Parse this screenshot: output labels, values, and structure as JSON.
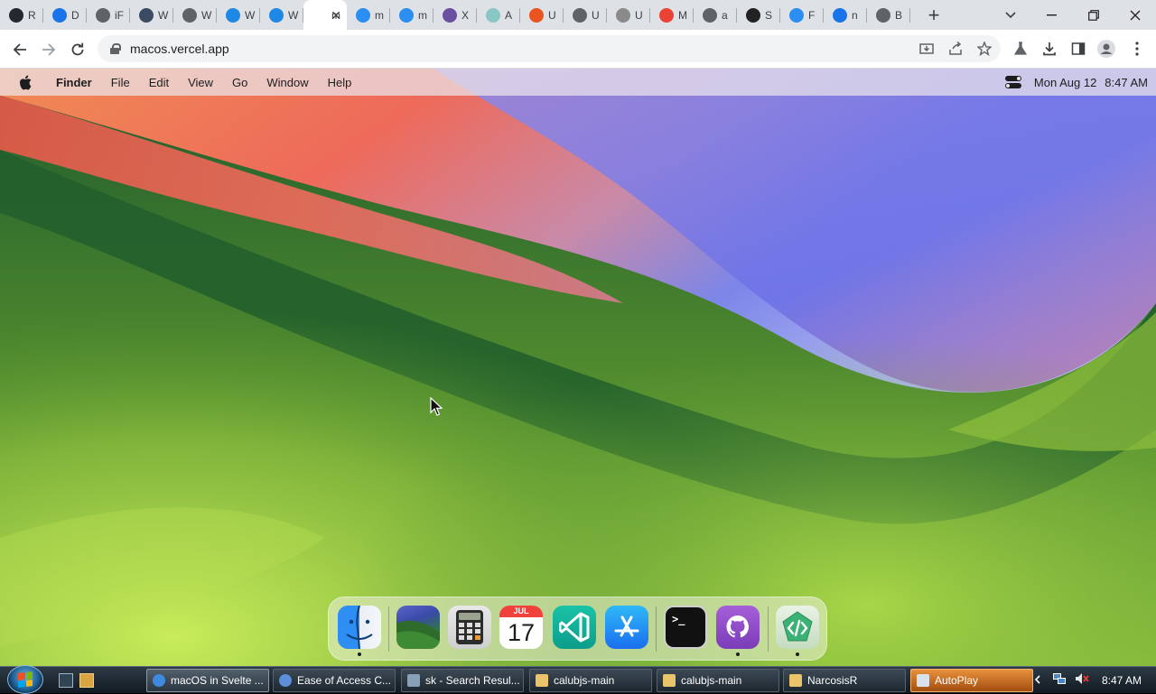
{
  "browser": {
    "tabs": [
      {
        "label": "R",
        "icon": "github-icon",
        "color": "#24292f"
      },
      {
        "label": "D",
        "icon": "download-icon",
        "color": "#1a73e8"
      },
      {
        "label": "iF",
        "icon": "globe-icon",
        "color": "#5f6368"
      },
      {
        "label": "W",
        "icon": "app-icon",
        "color": "#3b4b64"
      },
      {
        "label": "W",
        "icon": "globe-icon",
        "color": "#5f6368"
      },
      {
        "label": "W",
        "icon": "windows-icon",
        "color": "#1e88e5"
      },
      {
        "label": "W",
        "icon": "windows-icon",
        "color": "#1e88e5"
      },
      {
        "label": "m",
        "icon": "page-icon",
        "color": "#ffffff",
        "active": true
      },
      {
        "label": "m",
        "icon": "finder-icon",
        "color": "#2a8ff0"
      },
      {
        "label": "m",
        "icon": "finder-icon",
        "color": "#2a8ff0"
      },
      {
        "label": "X",
        "icon": "monster-icon",
        "color": "#6b4fa0"
      },
      {
        "label": "A",
        "icon": "aqua-icon",
        "color": "#88c7c4"
      },
      {
        "label": "U",
        "icon": "ubuntu-icon",
        "color": "#e95420"
      },
      {
        "label": "U",
        "icon": "globe-icon",
        "color": "#5f6368"
      },
      {
        "label": "U",
        "icon": "loading-icon",
        "color": "#8a8a8a"
      },
      {
        "label": "M",
        "icon": "chrome-icon",
        "color": "#ea4335"
      },
      {
        "label": "a",
        "icon": "globe-icon",
        "color": "#5f6368"
      },
      {
        "label": "S",
        "icon": "svelte-icon",
        "color": "#222222"
      },
      {
        "label": "F",
        "icon": "finder-icon",
        "color": "#2a8ff0"
      },
      {
        "label": "n",
        "icon": "search-icon",
        "color": "#1a73e8"
      },
      {
        "label": "B",
        "icon": "globe-icon",
        "color": "#5f6368"
      }
    ],
    "url": "macos.vercel.app"
  },
  "macos": {
    "menu": {
      "app": "Finder",
      "items": [
        "File",
        "Edit",
        "View",
        "Go",
        "Window",
        "Help"
      ]
    },
    "clock": {
      "date": "Mon Aug 12",
      "time": "8:47 AM"
    },
    "dock": {
      "calendar_month": "JUL",
      "calendar_day": "17",
      "terminal_prompt": ">_",
      "apps": [
        "finder",
        "wallpapers",
        "calculator",
        "calendar",
        "vscode",
        "app-store",
        "terminal",
        "github",
        "dev-tools"
      ]
    }
  },
  "taskbar": {
    "tasks": [
      {
        "label": "macOS in Svelte ...",
        "icon": "chrome-icon",
        "active": true
      },
      {
        "label": "Ease of Access C...",
        "icon": "control-panel-icon"
      },
      {
        "label": "sk - Search Resul...",
        "icon": "search-folder-icon"
      },
      {
        "label": "calubjs-main",
        "icon": "folder-icon"
      },
      {
        "label": "calubjs-main",
        "icon": "folder-icon"
      },
      {
        "label": "NarcosisR",
        "icon": "folder-icon"
      },
      {
        "label": "AutoPlay",
        "icon": "autoplay-icon",
        "highlight": true
      }
    ],
    "time": "8:47 AM"
  },
  "colors": {
    "accent": "#1a73e8",
    "menubar_text": "#1d1d1f",
    "taskbar_bg": "#1d2730"
  }
}
